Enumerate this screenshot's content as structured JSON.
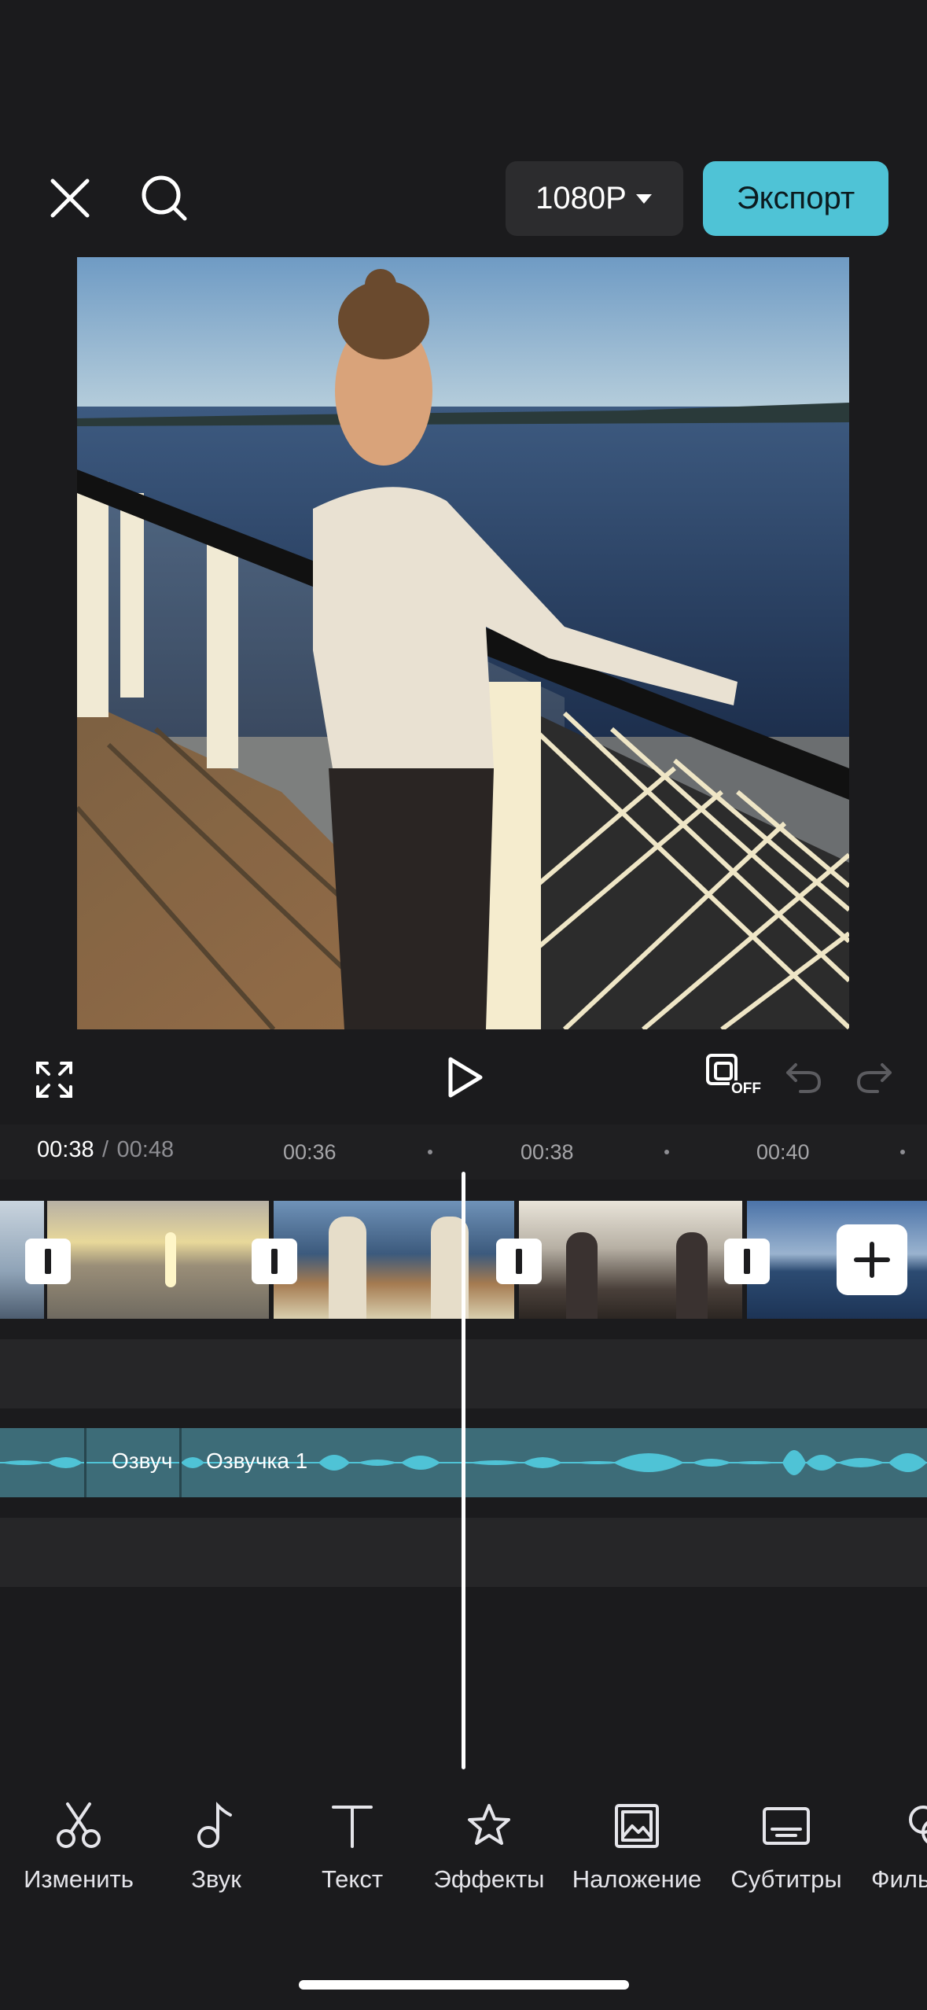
{
  "topbar": {
    "close_icon": "close-icon",
    "search_icon": "search-icon",
    "resolution": "1080P",
    "export_label": "Экспорт"
  },
  "preview": {
    "description_icon": "video-preview"
  },
  "controls": {
    "fullscreen_icon": "fullscreen-icon",
    "play_icon": "play-icon",
    "keyframe_off_label": "OFF",
    "undo_icon": "undo-icon",
    "redo_icon": "redo-icon"
  },
  "timeline": {
    "current_time": "00:38",
    "separator": "/",
    "total_time": "00:48",
    "ticks": [
      "00:36",
      "00:38",
      "00:40"
    ],
    "audio_labels": [
      "Озвуч",
      "Озвучка 1"
    ]
  },
  "toolbar": {
    "items": [
      {
        "label": "Изменить",
        "icon": "scissors-icon"
      },
      {
        "label": "Звук",
        "icon": "music-note-icon"
      },
      {
        "label": "Текст",
        "icon": "text-icon"
      },
      {
        "label": "Эффекты",
        "icon": "star-effects-icon"
      },
      {
        "label": "Наложение",
        "icon": "overlay-image-icon"
      },
      {
        "label": "Субтитры",
        "icon": "subtitles-icon"
      },
      {
        "label": "Филь",
        "icon": "filters-icon"
      }
    ]
  },
  "colors": {
    "accent": "#4fc3d6",
    "background": "#1b1b1d",
    "audio_track": "#3d6c78"
  }
}
